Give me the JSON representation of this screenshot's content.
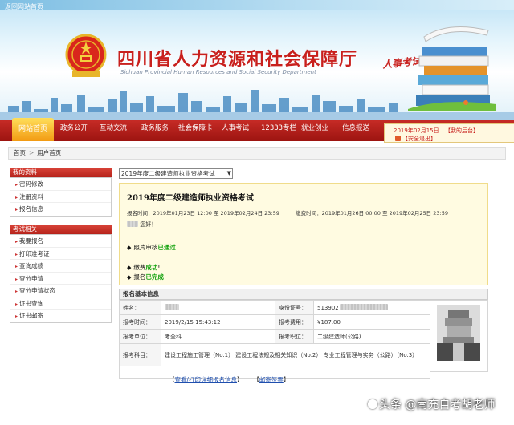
{
  "header": {
    "top_link": "返回网站首页",
    "title": "四川省人力资源和社会保障厅",
    "subtitle": "Sichuan Provincial Human Resources and Social Security Department",
    "column": "人事考试专栏"
  },
  "nav": {
    "items": [
      "网站首页",
      "政务公开",
      "互动交流",
      "政务服务",
      "社会保障卡",
      "人事考试",
      "12333专栏",
      "就业创业",
      "信息报送"
    ],
    "date": "2019年02月15日",
    "backstage": "【我的后台】",
    "logout": "【安全退出】"
  },
  "breadcrumb": [
    "首页",
    "用户首页"
  ],
  "sidebar": {
    "my_info_title": "我的资料",
    "my_info_items": [
      "密码修改",
      "注册资料",
      "报名信息"
    ],
    "exam_title": "考试相关",
    "exam_items": [
      "我要报名",
      "打印准考证",
      "查询成绩",
      "查分申请",
      "查分申请状态",
      "证书查询",
      "证书邮寄"
    ]
  },
  "main": {
    "exam_select": "2019年度二级建造师执业资格考试",
    "notice": {
      "title": "2019年度二级建造师执业资格考试",
      "signup_label": "报名时间：",
      "signup_time": "2019年01月23日 12:00 至 2019年02月24日 23:59",
      "pay_label": "缴费时间：",
      "pay_time": "2019年01月26日 00:00 至 2019年02月25日 23:59",
      "hello": "您好！",
      "line1_prefix": "照片审核",
      "line1_status": "已通过",
      "line1_suffix": "!",
      "line2_prefix": "缴费",
      "line2_status": "成功",
      "line2_suffix": "!",
      "line3_prefix": "报名",
      "line3_status": "已完成",
      "line3_suffix": "!"
    },
    "info": {
      "header": "报名基本信息",
      "name_label": "姓名：",
      "id_label": "身份证号：",
      "id_value": "513902",
      "time_label": "报考时间：",
      "time_value": "2019/2/15 15:43:12",
      "fee_label": "报考费用：",
      "fee_value": "¥187.00",
      "unit_label": "报考单位：",
      "unit_value": "考全科",
      "position_label": "报考职位：",
      "position_value": "二级建造师(公路)",
      "subject_label": "报考科目：",
      "subject_value": "建设工程施工管理（No.1） 建设工程法规及相关知识（No.2） 专业工程管理与实务（公路）（No.3）",
      "link1": "查看/打印详细报名信息",
      "link2": "邮寄签票"
    }
  },
  "watermark": "头条 @南充自考胡老师",
  "colors": {
    "nav_red": "#b5231b",
    "title_red": "#c8201d",
    "notice_bg": "#fffbe1",
    "success_green": "#14a20f",
    "link_blue": "#1f4fae"
  }
}
